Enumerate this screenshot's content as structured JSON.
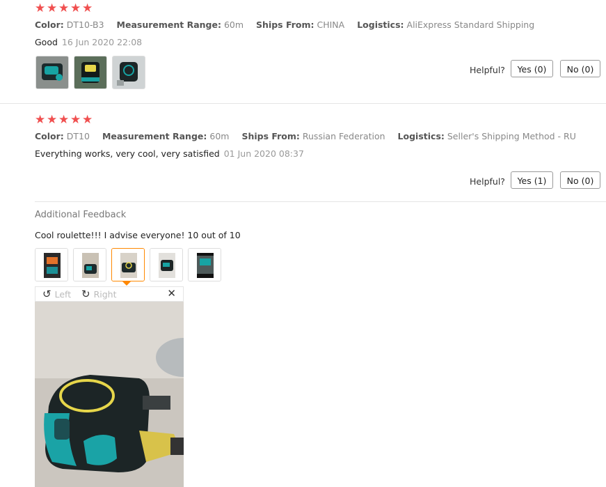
{
  "reviews": [
    {
      "rating": 5,
      "properties": [
        {
          "key": "Color:",
          "value": "DT10-B3"
        },
        {
          "key": "Measurement Range:",
          "value": "60m"
        },
        {
          "key": "Ships From:",
          "value": "CHINA"
        },
        {
          "key": "Logistics:",
          "value": "AliExpress Standard Shipping"
        }
      ],
      "text": "Good",
      "date": "16 Jun 2020 22:08",
      "helpful_label": "Helpful?",
      "yes_label": "Yes (0)",
      "no_label": "No (0)"
    },
    {
      "rating": 5,
      "properties": [
        {
          "key": "Color:",
          "value": "DT10"
        },
        {
          "key": "Measurement Range:",
          "value": "60m"
        },
        {
          "key": "Ships From:",
          "value": "Russian Federation"
        },
        {
          "key": "Logistics:",
          "value": "Seller's Shipping Method - RU"
        }
      ],
      "text": "Everything works, very cool, very satisfied",
      "date": "01 Jun 2020 08:37",
      "helpful_label": "Helpful?",
      "yes_label": "Yes (1)",
      "no_label": "No (0)",
      "additional": {
        "heading": "Additional Feedback",
        "text": "Cool roulette!!! I advise everyone! 10 out of 10",
        "selected_photo": 3
      }
    }
  ],
  "viewer": {
    "rotate_left_label": "Left",
    "rotate_right_label": "Right",
    "rotate_left_icon": "rotate-left-icon",
    "rotate_right_icon": "rotate-right-icon",
    "close_icon": "close-icon"
  },
  "colors": {
    "star": "#f04f4f",
    "accent": "#ff8800"
  }
}
